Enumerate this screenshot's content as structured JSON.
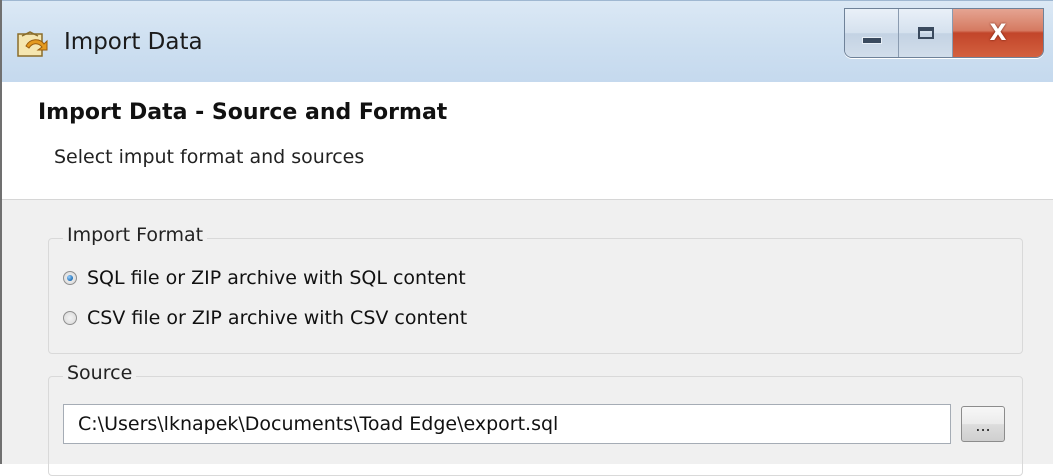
{
  "window": {
    "title": "Import Data",
    "close_glyph": "X"
  },
  "header": {
    "title": "Import Data - Source and Format",
    "subtitle": "Select imput format and sources"
  },
  "import_format": {
    "legend": "Import Format",
    "options": [
      {
        "label": "SQL file or ZIP archive with SQL content",
        "selected": true
      },
      {
        "label": "CSV file or ZIP archive with CSV content",
        "selected": false
      }
    ]
  },
  "source": {
    "legend": "Source",
    "path_value": "C:\\Users\\lknapek\\Documents\\Toad Edge\\export.sql",
    "browse_label": "..."
  },
  "colors": {
    "titlebar": "#cddff0",
    "close_button": "#c2452a",
    "body_background": "#f0f0f0"
  },
  "icons": {
    "app": "import-data-icon",
    "minimize": "minimize-icon",
    "maximize": "maximize-icon",
    "close": "close-icon"
  }
}
